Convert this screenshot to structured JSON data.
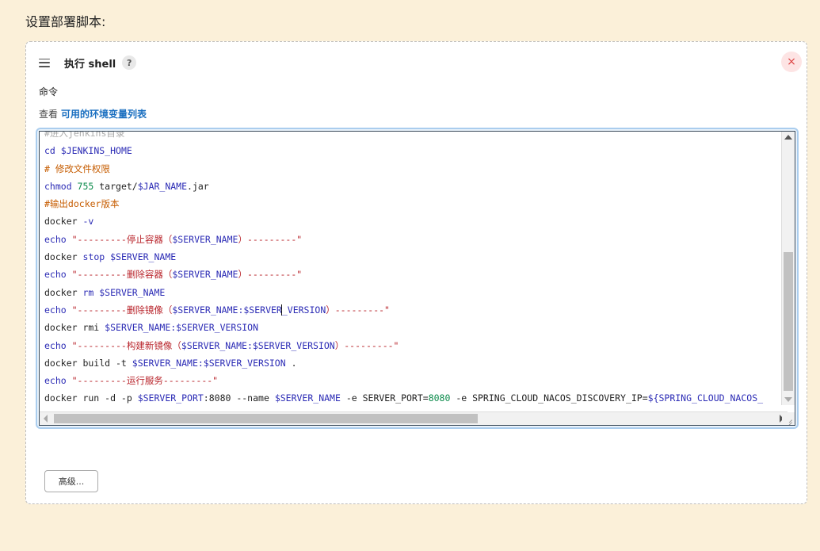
{
  "page": {
    "heading": "设置部署脚本:"
  },
  "step": {
    "title": "执行 shell",
    "help_icon": "?",
    "close_icon": "×",
    "command_label": "命令",
    "env_prefix": "查看",
    "env_link": "可用的环境变量列表",
    "advanced_button": "高级..."
  },
  "editor": {
    "lines": [
      [
        {
          "t": "#进入jenkins目录",
          "c": "faded"
        }
      ],
      [
        {
          "t": "cd ",
          "c": "kw"
        },
        {
          "t": "$JENKINS_HOME",
          "c": "kw"
        }
      ],
      [
        {
          "t": "# 修改文件权限",
          "c": "cmt"
        }
      ],
      [
        {
          "t": "chmod ",
          "c": "kw"
        },
        {
          "t": "755",
          "c": "num"
        },
        {
          "t": " target/",
          "c": "plain"
        },
        {
          "t": "$JAR_NAME",
          "c": "kw"
        },
        {
          "t": ".jar",
          "c": "plain"
        }
      ],
      [
        {
          "t": "#输出docker版本",
          "c": "cmt"
        }
      ],
      [
        {
          "t": "docker ",
          "c": "plain"
        },
        {
          "t": "-v",
          "c": "kw"
        }
      ],
      [
        {
          "t": "echo ",
          "c": "kw"
        },
        {
          "t": "\"---------停止容器（",
          "c": "str"
        },
        {
          "t": "$SERVER_NAME",
          "c": "kw"
        },
        {
          "t": "）---------\"",
          "c": "str"
        }
      ],
      [
        {
          "t": "docker ",
          "c": "plain"
        },
        {
          "t": "stop ",
          "c": "kw"
        },
        {
          "t": "$SERVER_NAME",
          "c": "kw"
        }
      ],
      [
        {
          "t": "echo ",
          "c": "kw"
        },
        {
          "t": "\"---------删除容器（",
          "c": "str"
        },
        {
          "t": "$SERVER_NAME",
          "c": "kw"
        },
        {
          "t": "）---------\"",
          "c": "str"
        }
      ],
      [
        {
          "t": "docker ",
          "c": "plain"
        },
        {
          "t": "rm ",
          "c": "kw"
        },
        {
          "t": "$SERVER_NAME",
          "c": "kw"
        }
      ],
      [
        {
          "t": "echo ",
          "c": "kw"
        },
        {
          "t": "\"---------删除镜像（",
          "c": "str"
        },
        {
          "t": "$SERVER_NAME:$SERVER",
          "c": "kw"
        },
        {
          "t": "|",
          "c": "cursor"
        },
        {
          "t": "_VERSION",
          "c": "kw"
        },
        {
          "t": "）---------\"",
          "c": "str"
        }
      ],
      [
        {
          "t": "docker rmi ",
          "c": "plain"
        },
        {
          "t": "$SERVER_NAME:$SERVER_VERSION",
          "c": "kw"
        }
      ],
      [
        {
          "t": "echo ",
          "c": "kw"
        },
        {
          "t": "\"---------构建新镜像（",
          "c": "str"
        },
        {
          "t": "$SERVER_NAME:$SERVER_VERSION",
          "c": "kw"
        },
        {
          "t": "）---------\"",
          "c": "str"
        }
      ],
      [
        {
          "t": "docker build -t ",
          "c": "plain"
        },
        {
          "t": "$SERVER_NAME:$SERVER_VERSION",
          "c": "kw"
        },
        {
          "t": " .",
          "c": "plain"
        }
      ],
      [
        {
          "t": "echo ",
          "c": "kw"
        },
        {
          "t": "\"---------运行服务---------\"",
          "c": "str"
        }
      ],
      [
        {
          "t": "docker run -d -p ",
          "c": "plain"
        },
        {
          "t": "$SERVER_PORT",
          "c": "kw"
        },
        {
          "t": ":8080 --name ",
          "c": "plain"
        },
        {
          "t": "$SERVER_NAME",
          "c": "kw"
        },
        {
          "t": " -e SERVER_PORT=",
          "c": "plain"
        },
        {
          "t": "8080",
          "c": "num"
        },
        {
          "t": " -e SPRING_CLOUD_NACOS_DISCOVERY_IP=",
          "c": "plain"
        },
        {
          "t": "${SPRING_CLOUD_NACOS_",
          "c": "kw"
        }
      ]
    ]
  },
  "colors": {
    "page_bg": "#fbf0d9",
    "keyword": "#2b2bb5",
    "string": "#b8232a",
    "comment": "#c65c00",
    "number": "#0a8a4a",
    "link": "#1a6fc0"
  }
}
